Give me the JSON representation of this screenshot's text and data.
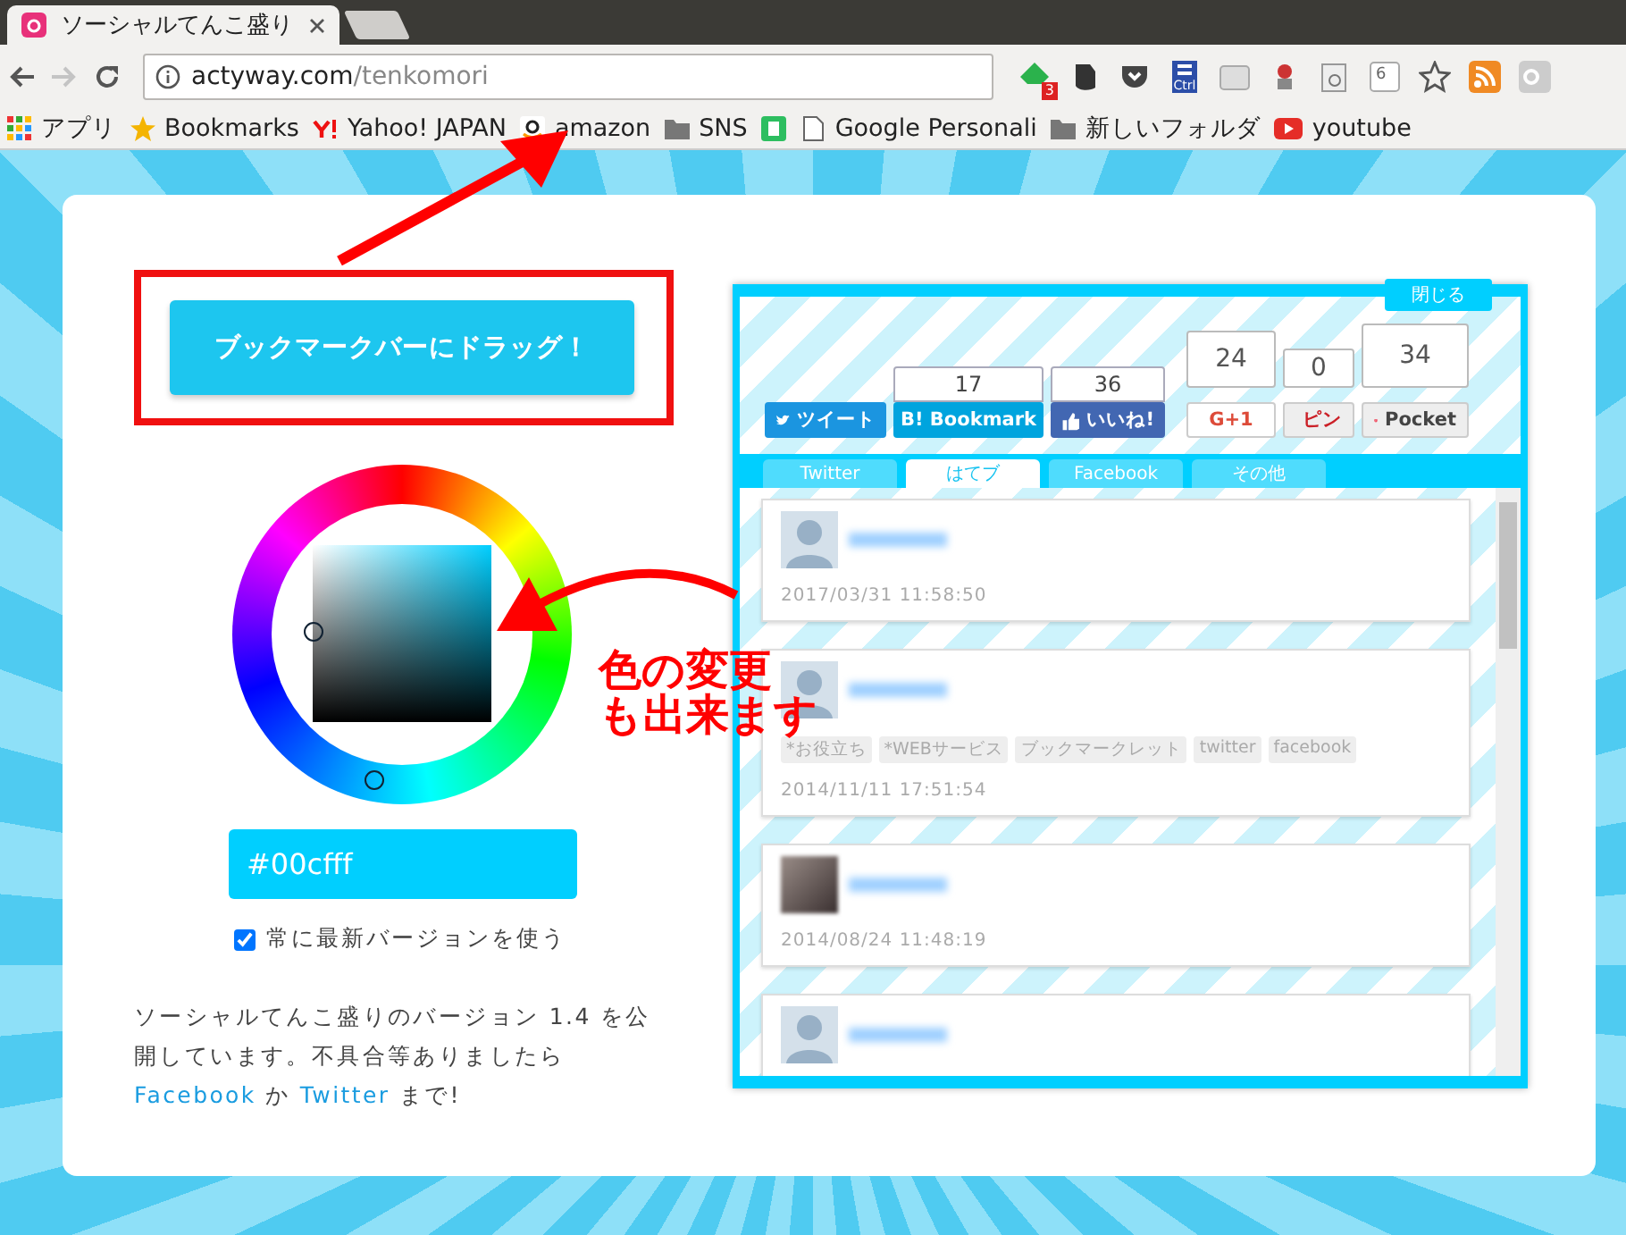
{
  "browser": {
    "tab": {
      "title": "ソーシャルてんこ盛り"
    },
    "address": {
      "host": "actyway.com",
      "path": "/tenkomori"
    },
    "extensions": [
      {
        "kind": "feedly",
        "text": "3"
      },
      {
        "kind": "evernote"
      },
      {
        "kind": "pocket"
      },
      {
        "kind": "ctrl",
        "text": "Ctrl"
      },
      {
        "kind": "keyboard"
      },
      {
        "kind": "stamp"
      },
      {
        "kind": "mail"
      },
      {
        "kind": "number",
        "text": "6"
      },
      {
        "kind": "star"
      },
      {
        "kind": "rss"
      },
      {
        "kind": "gplus"
      }
    ],
    "bookmarks": [
      {
        "kind": "apps",
        "label": "アプリ"
      },
      {
        "kind": "star",
        "label": "Bookmarks"
      },
      {
        "kind": "yahoo",
        "label": "Yahoo! JAPAN"
      },
      {
        "kind": "amazon",
        "label": "amazon"
      },
      {
        "kind": "folder",
        "label": "SNS"
      },
      {
        "kind": "evernote"
      },
      {
        "kind": "page",
        "label": "Google Personali"
      },
      {
        "kind": "folder",
        "label": "新しいフォルダ"
      },
      {
        "kind": "youtube",
        "label": "youtube"
      }
    ]
  },
  "editor": {
    "bookmarklet_button": "ブックマークバーにドラッグ！",
    "color_value": "#00cfff",
    "always_latest": {
      "label": "常に最新バージョンを使う",
      "checked": true
    },
    "description": [
      {
        "kind": "text",
        "text": "ソーシャルてんこ盛りのバージョン 1.4 を公開しています。不具合等ありましたら "
      },
      {
        "kind": "link",
        "text": "Facebook"
      },
      {
        "kind": "text",
        "text": " か "
      },
      {
        "kind": "link",
        "text": "Twitter"
      },
      {
        "kind": "text",
        "text": " まで!"
      }
    ]
  },
  "preview": {
    "close_button": "閉じる",
    "share": [
      {
        "kind": "tweet",
        "label": "ツイート"
      },
      {
        "kind": "hatena",
        "label": "B! Bookmark",
        "count": "17"
      },
      {
        "kind": "like",
        "label": "いいね!",
        "count": "36"
      },
      {
        "kind": "gplus",
        "label": "G+1",
        "count": "24"
      },
      {
        "kind": "pin",
        "label": "ピン",
        "count": "0"
      },
      {
        "kind": "pocket",
        "label": "Pocket",
        "count": "34"
      }
    ],
    "tabs": [
      {
        "label": "Twitter",
        "selected": false
      },
      {
        "label": "はてブ",
        "selected": true
      },
      {
        "label": "Facebook",
        "selected": false
      },
      {
        "label": "その他",
        "selected": false
      }
    ],
    "entries": [
      {
        "kind": "silhouette",
        "date": "2017/03/31 11:58:50"
      },
      {
        "kind": "silhouette",
        "tags": [
          "*お役立ち",
          "*WEBサービス",
          "ブックマークレット",
          "twitter",
          "facebook"
        ],
        "date": "2014/11/11 17:51:54"
      },
      {
        "kind": "photo",
        "date": "2014/08/24 11:48:19"
      },
      {
        "kind": "silhouette"
      }
    ]
  },
  "annotation": {
    "lines": [
      "色の変更",
      "も出来ます"
    ]
  }
}
